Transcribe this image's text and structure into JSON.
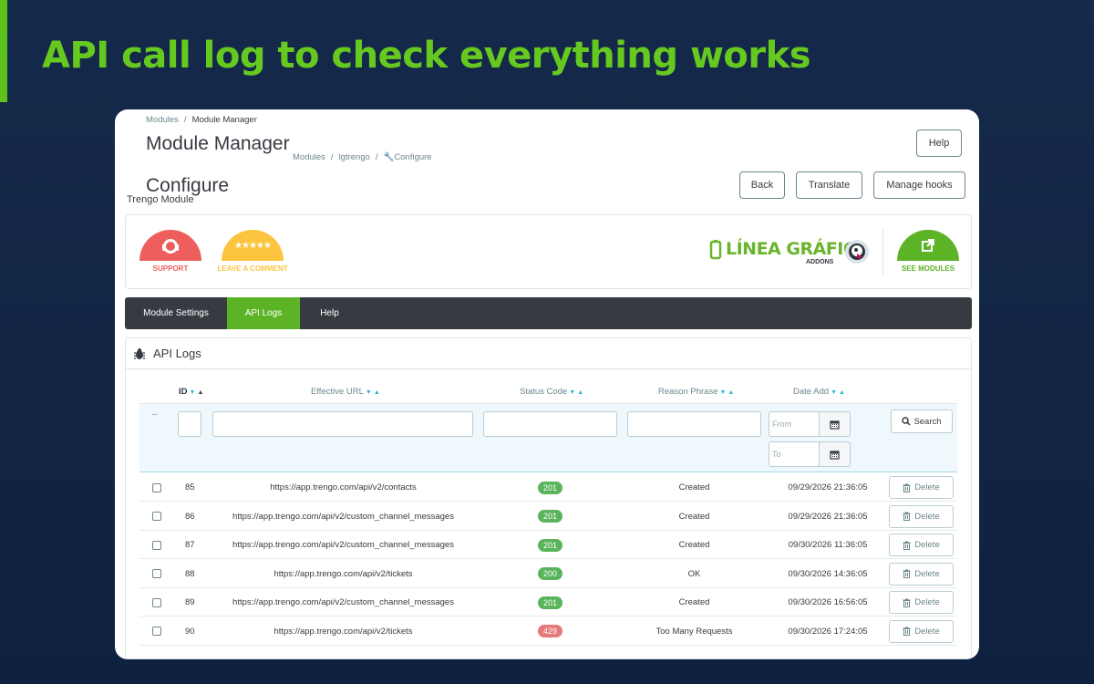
{
  "headline": "API call log to check everything works",
  "breadcrumb_top": {
    "root": "Modules",
    "sep": "/",
    "current": "Module Manager"
  },
  "page_title": "Module Manager",
  "breadcrumb_second": {
    "a": "Modules",
    "b": "lgtrengo",
    "c": "Configure",
    "sep": "/"
  },
  "sub_title": "Configure",
  "sub_small": "Trengo Module",
  "toolbar": {
    "help": "Help",
    "back": "Back",
    "translate": "Translate",
    "manage_hooks": "Manage hooks"
  },
  "panel": {
    "support": "SUPPORT",
    "leave_comment": "LEAVE A COMMENT",
    "stars": "★★★★★",
    "brand_main": "LÍNEA GRÁFICA",
    "brand_sub": "ADDONS",
    "see_modules": "SEE MODULES"
  },
  "colors": {
    "red": "#ed5e5c",
    "yellow": "#fcc43f",
    "green": "#5cb325",
    "badge_ok": "#5ab45b",
    "badge_err": "#e6797a",
    "accent": "#66c91f"
  },
  "tabs": [
    {
      "label": "Module Settings",
      "active": false
    },
    {
      "label": "API Logs",
      "active": true
    },
    {
      "label": "Help",
      "active": false
    }
  ],
  "logs": {
    "title": "API Logs",
    "columns": {
      "id": "ID",
      "url": "Effective URL",
      "status": "Status Code",
      "reason": "Reason Phrase",
      "date": "Date Add"
    },
    "filter_dash": "--",
    "from_placeholder": "From",
    "to_placeholder": "To",
    "search_label": "Search",
    "delete_label": "Delete",
    "rows": [
      {
        "id": "85",
        "url": "https://app.trengo.com/api/v2/contacts",
        "status": "201",
        "reason": "Created",
        "date": "09/29/2026 21:36:05"
      },
      {
        "id": "86",
        "url": "https://app.trengo.com/api/v2/custom_channel_messages",
        "status": "201",
        "reason": "Created",
        "date": "09/29/2026 21:36:05"
      },
      {
        "id": "87",
        "url": "https://app.trengo.com/api/v2/custom_channel_messages",
        "status": "201",
        "reason": "Created",
        "date": "09/30/2026 11:36:05"
      },
      {
        "id": "88",
        "url": "https://app.trengo.com/api/v2/tickets",
        "status": "200",
        "reason": "OK",
        "date": "09/30/2026 14:36:05"
      },
      {
        "id": "89",
        "url": "https://app.trengo.com/api/v2/custom_channel_messages",
        "status": "201",
        "reason": "Created",
        "date": "09/30/2026 16:56:05"
      },
      {
        "id": "90",
        "url": "https://app.trengo.com/api/v2/tickets",
        "status": "429",
        "reason": "Too Many Requests",
        "date": "09/30/2026 17:24:05"
      }
    ]
  }
}
